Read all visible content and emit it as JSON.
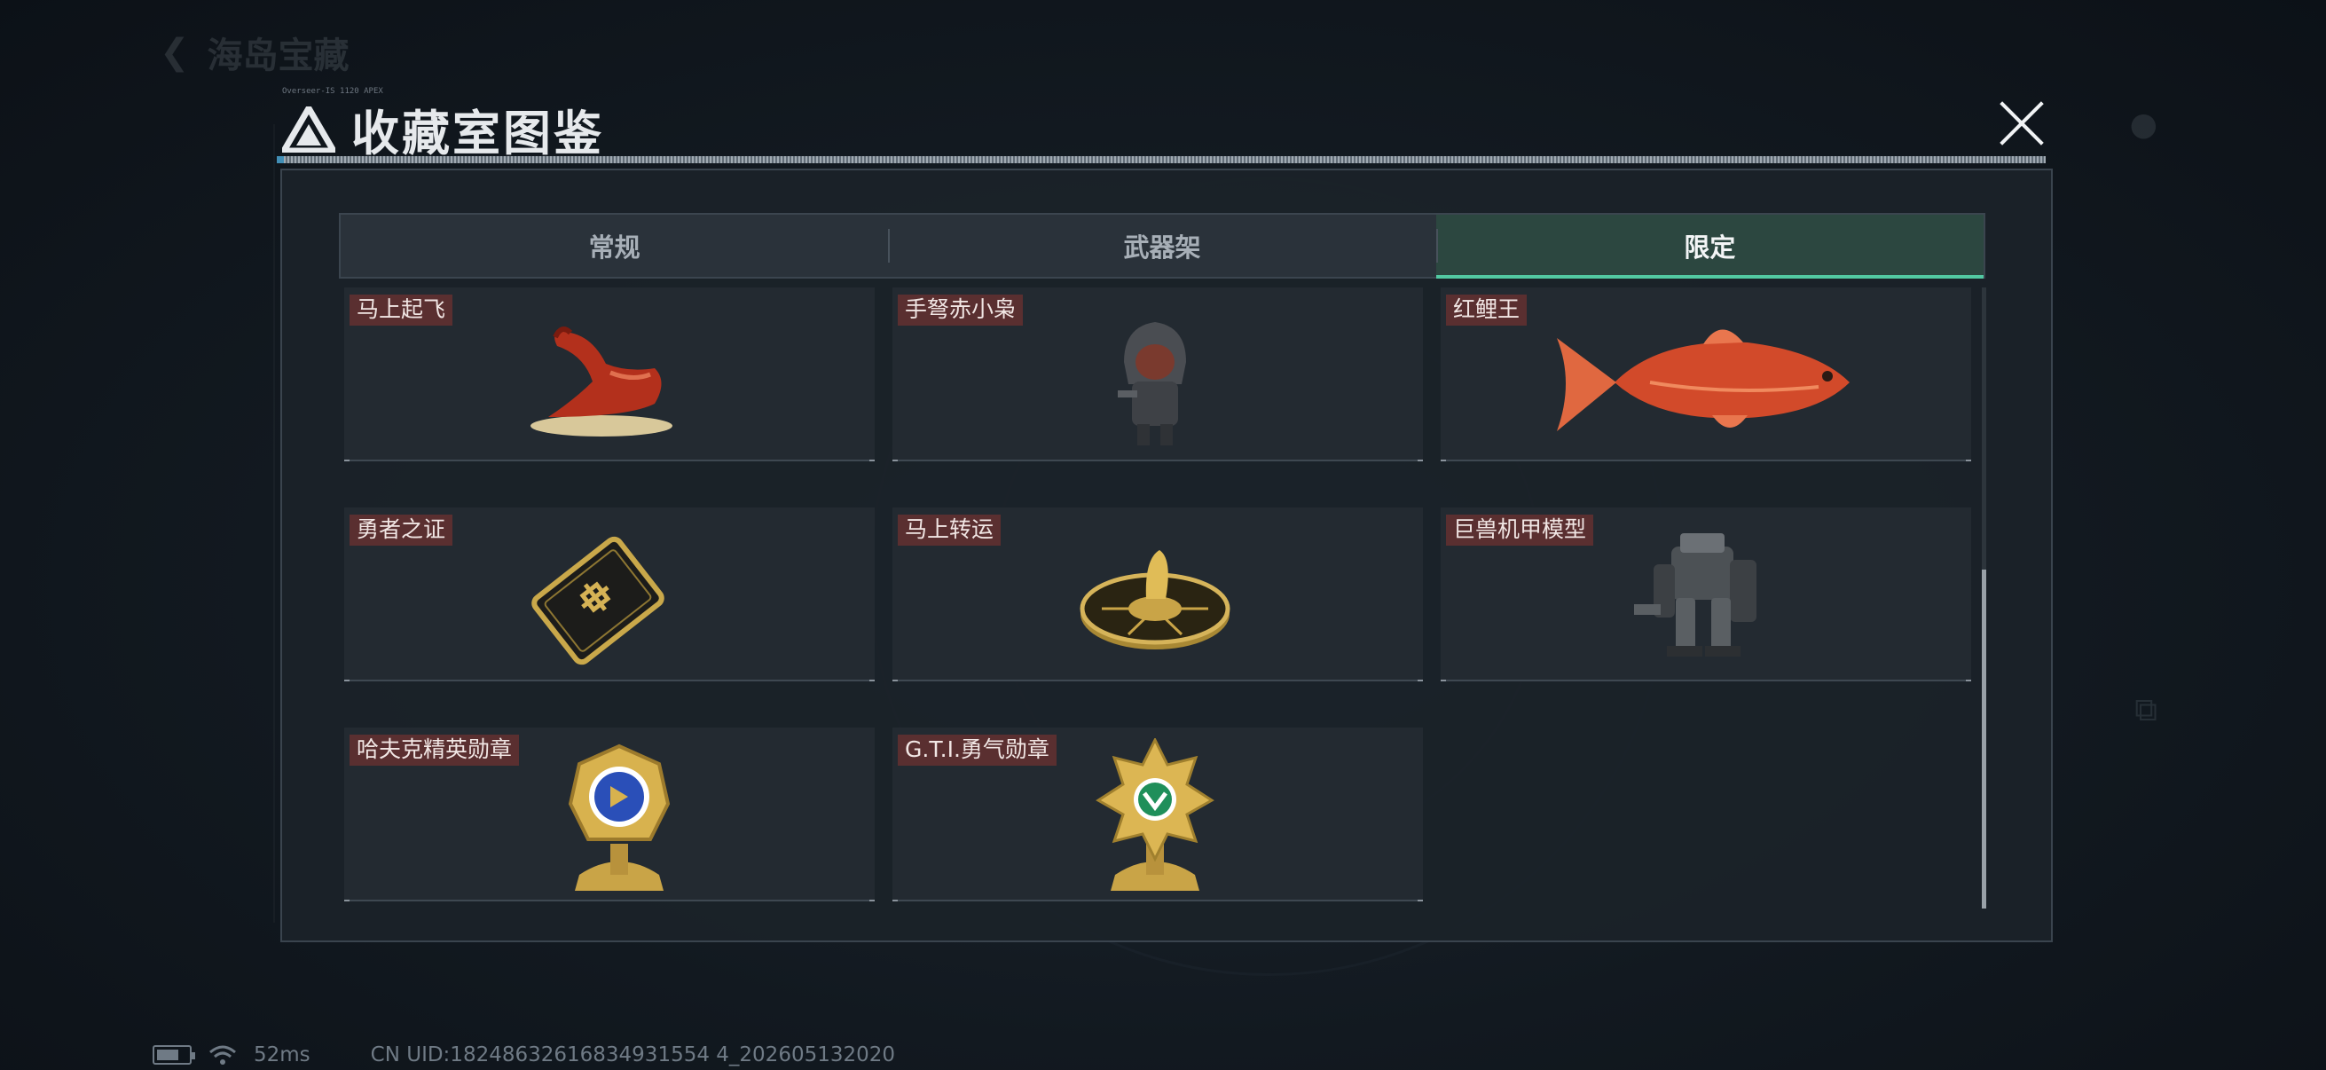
{
  "background": {
    "back_title": "海岛宝藏"
  },
  "modal": {
    "header_tiny_text": "Overseer-IS 1120 APEX",
    "title": "收藏室图鉴",
    "close_icon": "close-icon",
    "accent_color": "#52c9a2"
  },
  "tabs": [
    {
      "label": "常规",
      "active": false
    },
    {
      "label": "武器架",
      "active": false
    },
    {
      "label": "限定",
      "active": true
    }
  ],
  "items": [
    {
      "name": "马上起飞",
      "icon": "horse-statue-icon"
    },
    {
      "name": "手弩赤小枭",
      "icon": "hooded-figure-icon"
    },
    {
      "name": "红鲤王",
      "icon": "red-carp-icon"
    },
    {
      "name": "勇者之证",
      "icon": "gold-card-icon"
    },
    {
      "name": "马上转运",
      "icon": "golden-wheel-icon"
    },
    {
      "name": "巨兽机甲模型",
      "icon": "mech-model-icon"
    },
    {
      "name": "哈夫克精英勋章",
      "icon": "blue-medal-icon"
    },
    {
      "name": "G.T.I.勇气勋章",
      "icon": "green-medal-icon"
    }
  ],
  "status_bar": {
    "ping": "52ms",
    "uid": "CN UID:18248632616834931554 4_202605132020"
  }
}
